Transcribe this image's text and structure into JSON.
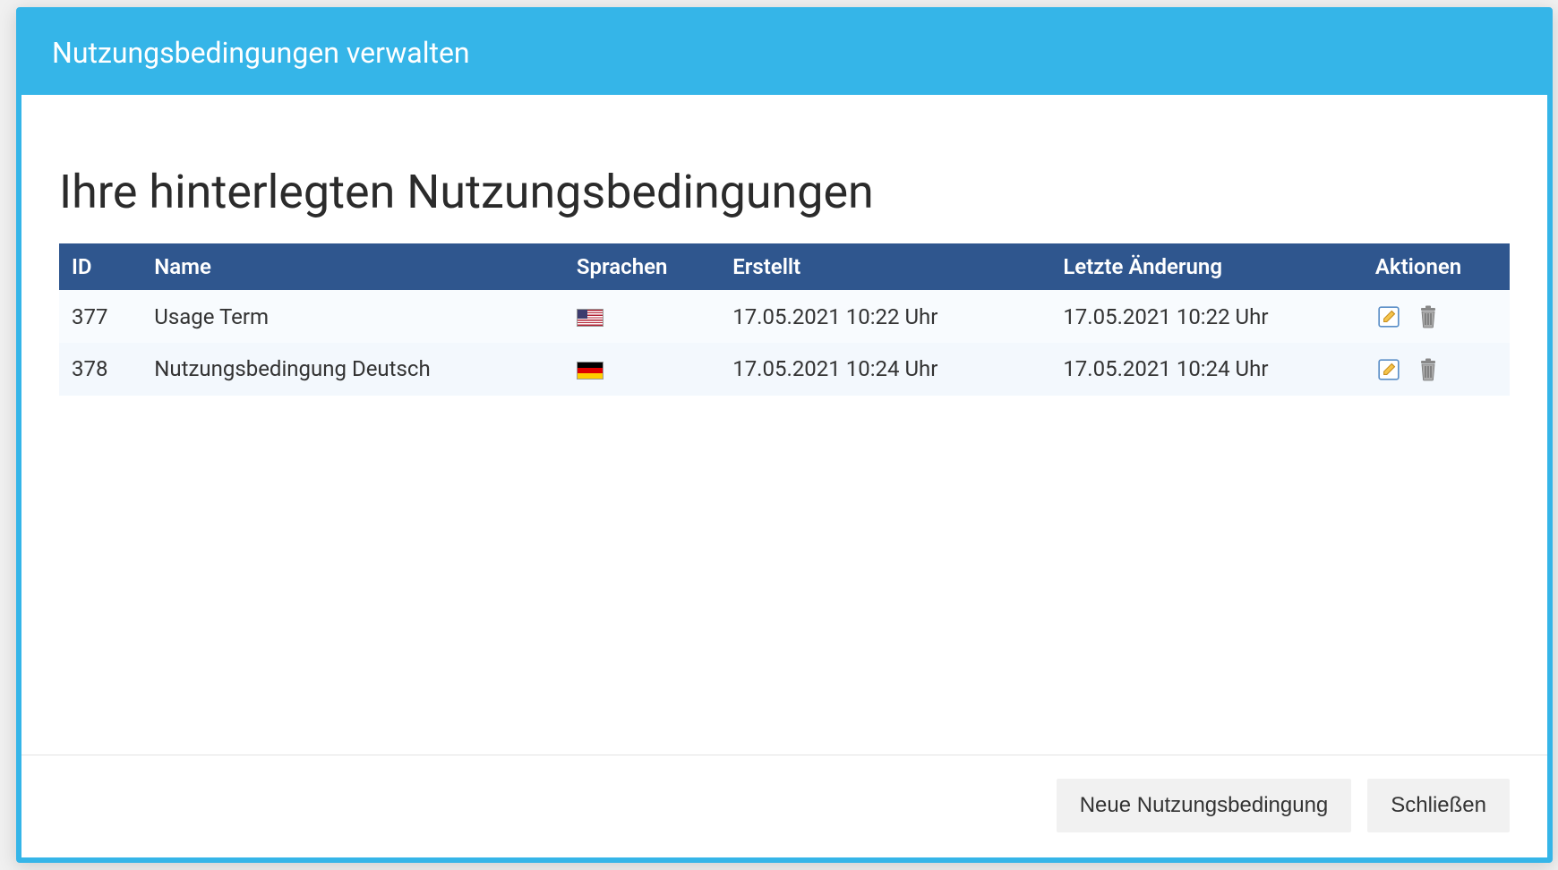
{
  "modal": {
    "title": "Nutzungsbedingungen verwalten",
    "section_heading": "Ihre hinterlegten Nutzungsbedingungen",
    "footer": {
      "new_label": "Neue Nutzungsbedingung",
      "close_label": "Schließen"
    }
  },
  "table": {
    "headers": {
      "id": "ID",
      "name": "Name",
      "languages": "Sprachen",
      "created": "Erstellt",
      "last_change": "Letzte Änderung",
      "actions": "Aktionen"
    },
    "rows": [
      {
        "id": "377",
        "name": "Usage Term",
        "flag": "us",
        "created": "17.05.2021 10:22 Uhr",
        "last_change": "17.05.2021 10:22 Uhr"
      },
      {
        "id": "378",
        "name": "Nutzungsbedingung Deutsch",
        "flag": "de",
        "created": "17.05.2021 10:24 Uhr",
        "last_change": "17.05.2021 10:24 Uhr"
      }
    ]
  },
  "icons": {
    "edit": "edit-icon",
    "delete": "trash-icon"
  }
}
